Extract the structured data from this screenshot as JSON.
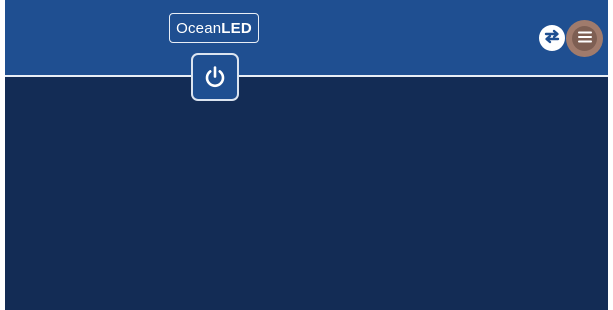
{
  "header": {
    "logo": {
      "text_light": "Ocean",
      "text_bold": "LED"
    },
    "power_button": {
      "icon": "power-icon"
    },
    "sync_button": {
      "icon": "sync-arrows-icon"
    },
    "menu_button": {
      "icon": "hamburger-menu-icon"
    }
  },
  "colors": {
    "header_background": "#1f4f91",
    "content_background": "#132c55",
    "divider": "#e8eef6",
    "menu_button": "#a07b6c",
    "icon_foreground": "#ffffff"
  }
}
